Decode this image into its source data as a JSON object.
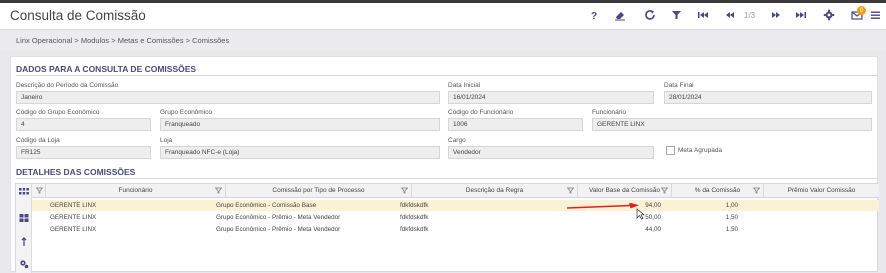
{
  "header": {
    "title": "Consulta de Comissão",
    "pager": "1/3",
    "notification_count": "0"
  },
  "breadcrumb": [
    "Linx Operacional",
    "Modulos",
    "Metas e Comissões",
    "Comissões"
  ],
  "breadcrumb_text": "Linx Operacional  >  Modulos  >  Metas e Comissões  >  Comissões",
  "form": {
    "section_title": "DADOS PARA A CONSULTA DE COMISSÕES",
    "descricao_periodo": {
      "label": "Descrição do Período da Comissão",
      "value": "Janeiro"
    },
    "data_inicial": {
      "label": "Data Inicial",
      "value": "16/01/2024"
    },
    "data_final": {
      "label": "Data Final",
      "value": "28/01/2024"
    },
    "codigo_grupo": {
      "label": "Código do Grupo Econômico",
      "value": "4"
    },
    "grupo": {
      "label": "Grupo Econômico",
      "value": "Franqueado"
    },
    "codigo_funcionario": {
      "label": "Código do Funcionário",
      "value": "1006"
    },
    "funcionario": {
      "label": "Funcionário",
      "value": "GERENTE LINX"
    },
    "codigo_loja": {
      "label": "Código da Loja",
      "value": "FR125"
    },
    "loja": {
      "label": "Loja",
      "value": "Franqueado NFC-e (Loja)"
    },
    "cargo": {
      "label": "Cargo",
      "value": "Vendedor"
    },
    "meta_agrupada": {
      "label": "Meta Agrupada",
      "checked": false
    }
  },
  "details": {
    "section_title": "DETALHES DAS COMISSÕES",
    "columns": [
      "Funcionário",
      "Comissão por Tipo de Processo",
      "Descrição da Regra",
      "Valor Base da Comissão",
      "% da Comissão",
      "Prêmio Valor Comissão"
    ],
    "rows": [
      [
        "GERENTE LINX",
        "Grupo Econômico - Comissão Base",
        "fdkfdskdfk",
        "94,00",
        "1,00",
        ""
      ],
      [
        "GERENTE LINX",
        "Grupo Econômico - Prêmio - Meta Vendedor",
        "fdkfdskdfk",
        "50,00",
        "1,50",
        ""
      ],
      [
        "GERENTE LINX",
        "Grupo Econômico - Prêmio - Meta Vendedor",
        "fdkfdskdfk",
        "44,00",
        "1,50",
        ""
      ]
    ]
  },
  "colors": {
    "accent": "#4a4a7a",
    "selected_row": "#fbf1d5",
    "arrow": "#e02020",
    "badge": "#f39c12"
  },
  "icons": [
    "help-icon",
    "eraser-icon",
    "refresh-icon",
    "filter-icon",
    "first-page-icon",
    "prev-page-icon",
    "next-page-icon",
    "last-page-icon",
    "settings-icon",
    "mail-icon",
    "menu-icon"
  ]
}
